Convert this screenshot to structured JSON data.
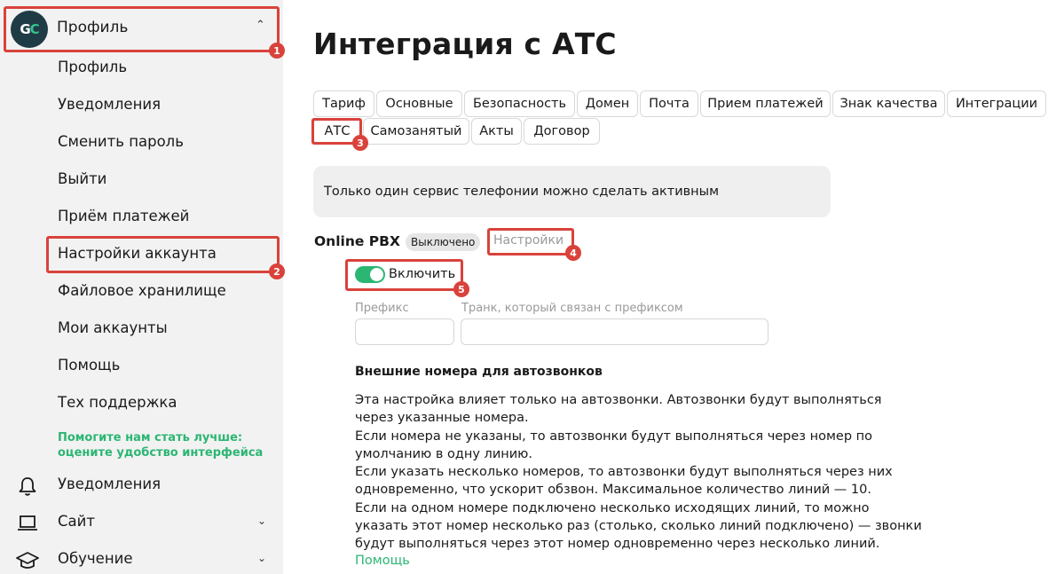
{
  "sidebar": {
    "logo_text": "GC",
    "profile_title": "Профиль",
    "items": [
      {
        "label": "Профиль"
      },
      {
        "label": "Уведомления"
      },
      {
        "label": "Сменить пароль"
      },
      {
        "label": "Выйти"
      },
      {
        "label": "Приём платежей"
      },
      {
        "label": "Настройки аккаунта"
      },
      {
        "label": "Файловое хранилище"
      },
      {
        "label": "Мои аккаунты"
      },
      {
        "label": "Помощь"
      },
      {
        "label": "Тех поддержка"
      }
    ],
    "feedback_line1": "Помогите нам стать лучше:",
    "feedback_line2": "оцените удобство интерфейса",
    "groups": [
      {
        "label": "Уведомления",
        "icon": "bell-icon"
      },
      {
        "label": "Сайт",
        "icon": "laptop-icon"
      },
      {
        "label": "Обучение",
        "icon": "graduation-cap-icon"
      }
    ]
  },
  "annotations": [
    "1",
    "2",
    "3",
    "4",
    "5"
  ],
  "main": {
    "title": "Интеграция с АТС",
    "tabs": [
      {
        "label": "Тариф"
      },
      {
        "label": "Основные"
      },
      {
        "label": "Безопасность"
      },
      {
        "label": "Домен"
      },
      {
        "label": "Почта"
      },
      {
        "label": "Прием платежей"
      },
      {
        "label": "Знак качества"
      },
      {
        "label": "Интеграции"
      },
      {
        "label": "АТС"
      },
      {
        "label": "Самозанятый"
      },
      {
        "label": "Акты"
      },
      {
        "label": "Договор"
      }
    ],
    "info_text": "Только один сервис телефонии можно сделать активным",
    "pbx": {
      "title": "Online PBX",
      "status": "Выключено",
      "settings_link": "Настройки",
      "toggle_label": "Включить",
      "toggle_on": true
    },
    "fields": {
      "prefix_label": "Префикс",
      "prefix_value": "",
      "trunk_label": "Транк, который связан с префиксом",
      "trunk_value": ""
    },
    "section_title": "Внешние номера для автозвонков",
    "description": [
      "Эта настройка влияет только на автозвонки. Автозвонки будут выполняться через указанные номера.",
      "Если номера не указаны, то автозвонки будут выполняться через номер по умолчанию в одну линию.",
      "Если указать несколько номеров, то автозвонки будут выполняться через них одновременно, что ускорит обзвон. Максимальное количество линий — 10.",
      "Если на одном номере подключено несколько исходящих линий, то можно указать этот номер несколько раз (столько, сколько линий подключено) — звонки будут выполняться через этот номер одновременно через несколько линий."
    ],
    "help_link": "Помощь"
  },
  "colors": {
    "accent_green": "#2bb673",
    "annotation_red": "#d9423b",
    "sidebar_bg": "#f2f2f2",
    "logo_bg": "#1f3c46"
  }
}
